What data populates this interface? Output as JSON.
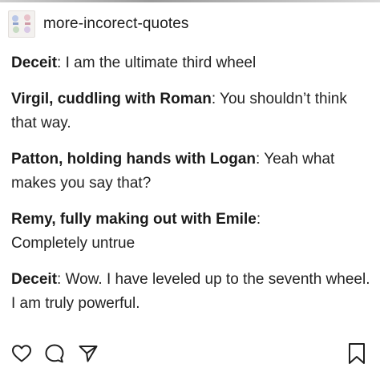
{
  "blog": {
    "name": "more-incorect-quotes"
  },
  "post": {
    "lines": [
      {
        "speaker": "Deceit",
        "separator": ": ",
        "text": "I am the ultimate third wheel"
      },
      {
        "speaker": "Virgil, cuddling with Roman",
        "separator": ": ",
        "text": "You shouldn’t think that way."
      },
      {
        "speaker": "Patton, holding hands with Logan",
        "separator": ": ",
        "text": "Yeah what makes you say that?"
      },
      {
        "speaker": "Remy, fully making out with Emile",
        "separator": ":",
        "text": "Completely untrue"
      },
      {
        "speaker": "Deceit",
        "separator": ": ",
        "text": "Wow. I have leveled up to the seventh wheel. I am truly powerful."
      }
    ]
  },
  "actions": {
    "icons": [
      "heart-icon",
      "comment-icon",
      "share-icon",
      "bookmark-icon"
    ]
  }
}
